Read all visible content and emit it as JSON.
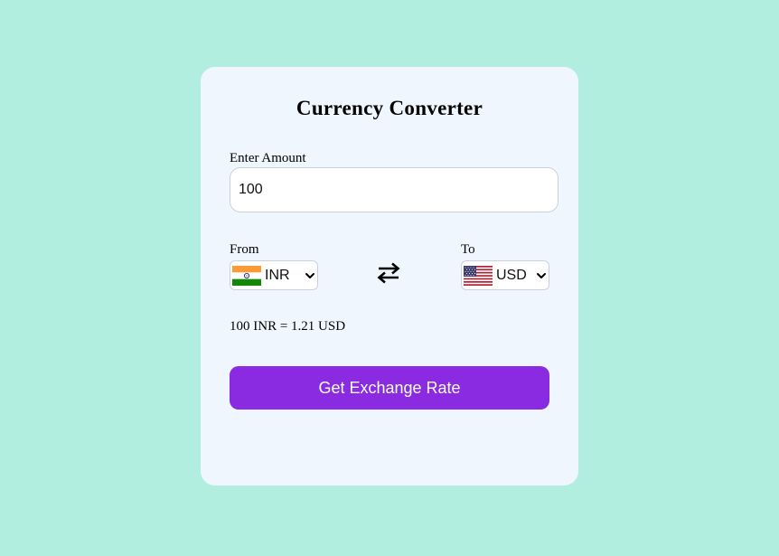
{
  "app": {
    "title": "Currency Converter"
  },
  "amount": {
    "label": "Enter Amount",
    "value": "100"
  },
  "from": {
    "label": "From",
    "currency": "INR",
    "flag_icon": "india-flag-icon"
  },
  "to": {
    "label": "To",
    "currency": "USD",
    "flag_icon": "usa-flag-icon"
  },
  "swap_icon": "swap-arrows-icon",
  "result_text": "100 INR = 1.21 USD",
  "button": {
    "label": "Get Exchange Rate",
    "color": "#8a2be2"
  },
  "colors": {
    "background": "#b2eedf",
    "card": "#eff6fe"
  }
}
